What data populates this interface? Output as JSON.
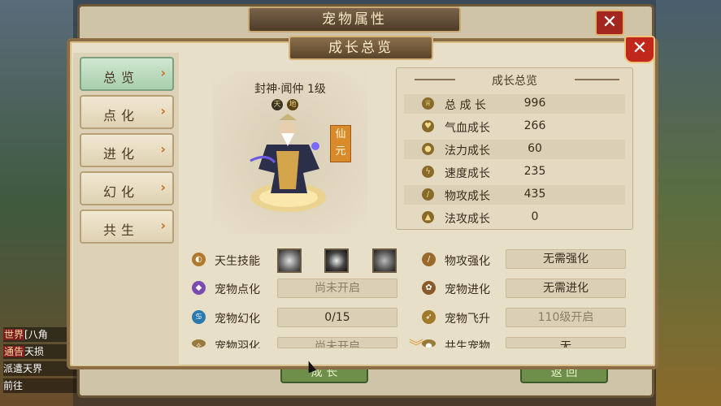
{
  "back_window": {
    "title": "宠物属性",
    "close_label": "✕",
    "bottom_left": "成 长",
    "bottom_right": "返 回"
  },
  "panel": {
    "title": "成长总览",
    "close_label": "✕"
  },
  "menu": [
    {
      "label": "总览",
      "active": true
    },
    {
      "label": "点化",
      "active": false
    },
    {
      "label": "进化",
      "active": false
    },
    {
      "label": "幻化",
      "active": false
    },
    {
      "label": "共生",
      "active": false
    }
  ],
  "pet": {
    "name": "封神·闻仲 1级",
    "badge1": "天",
    "badge2": "地",
    "tag": "仙元"
  },
  "growth": {
    "title": "成长总览",
    "rows": [
      {
        "label": "总 成 长",
        "value": "996",
        "icon": "trophy-icon"
      },
      {
        "label": "气血成长",
        "value": "266",
        "icon": "heart-icon"
      },
      {
        "label": "法力成长",
        "value": "60",
        "icon": "drop-icon"
      },
      {
        "label": "速度成长",
        "value": "235",
        "icon": "bolt-icon"
      },
      {
        "label": "物攻成长",
        "value": "435",
        "icon": "sword-icon"
      },
      {
        "label": "法攻成长",
        "value": "0",
        "icon": "flame-icon"
      }
    ]
  },
  "bottom": {
    "innate_skill_label": "天生技能",
    "pet_enlighten_label": "宠物点化",
    "pet_enlighten_value": "尚未开启",
    "pet_illusion_label": "宠物幻化",
    "pet_illusion_value": "0/15",
    "pet_feather_label": "宠物羽化",
    "pet_feather_value": "尚未开启",
    "phys_enhance_label": "物攻强化",
    "phys_enhance_value": "无需强化",
    "pet_evolve_label": "宠物进化",
    "pet_evolve_value": "无需进化",
    "pet_ascend_label": "宠物飞升",
    "pet_ascend_value": "110级开启",
    "symbiosis_label": "共生宠物",
    "symbiosis_value": "无"
  },
  "chat": {
    "line1_tag": "世界",
    "line1_text": "[八角",
    "line2_tag": "通告",
    "line2_text": "天损",
    "line3_text": "派遣天界",
    "line4_text": "前往"
  }
}
